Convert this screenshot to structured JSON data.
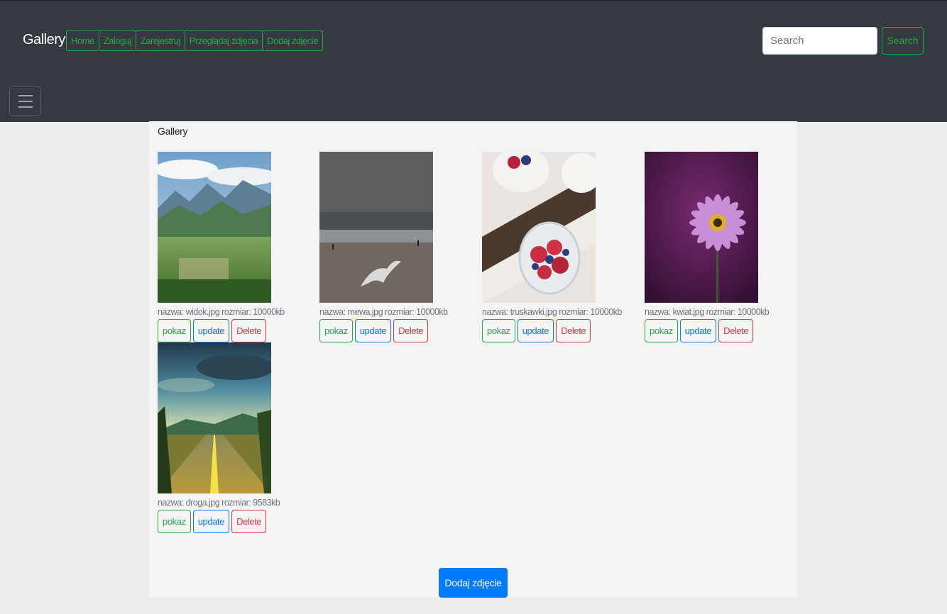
{
  "navbar": {
    "brand": "Gallery",
    "links": [
      "Home",
      "Zaloguj",
      "Zarejestruj",
      "Przeglądaj zdjęcia",
      "Dodaj zdjęcie"
    ],
    "search_placeholder": "Search",
    "search_button": "Search",
    "toggler_icon": "hamburger-icon"
  },
  "main": {
    "title": "Gallery",
    "items": [
      {
        "image": "mountain-valley-photo",
        "caption": "nazwa: widok.jpg rozmiar: 10000kb"
      },
      {
        "image": "seagull-beach-photo",
        "caption": "nazwa: mewa.jpg rozmiar: 10000kb"
      },
      {
        "image": "berries-jar-photo",
        "caption": "nazwa: truskawki.jpg rozmiar: 10000kb"
      },
      {
        "image": "purple-flower-photo",
        "caption": "nazwa: kwiat.jpg rozmiar: 10000kb"
      },
      {
        "image": "road-landscape-photo",
        "caption": "nazwa: droga.jpg rozmiar: 9583kb"
      }
    ],
    "actions": {
      "show": "pokaz",
      "update": "update",
      "delete": "Delete"
    },
    "add_button": "Dodaj zdjęcie"
  },
  "colors": {
    "navbar_bg": "#343a40",
    "success": "#28a745",
    "primary": "#007bff",
    "danger": "#dc3545"
  }
}
